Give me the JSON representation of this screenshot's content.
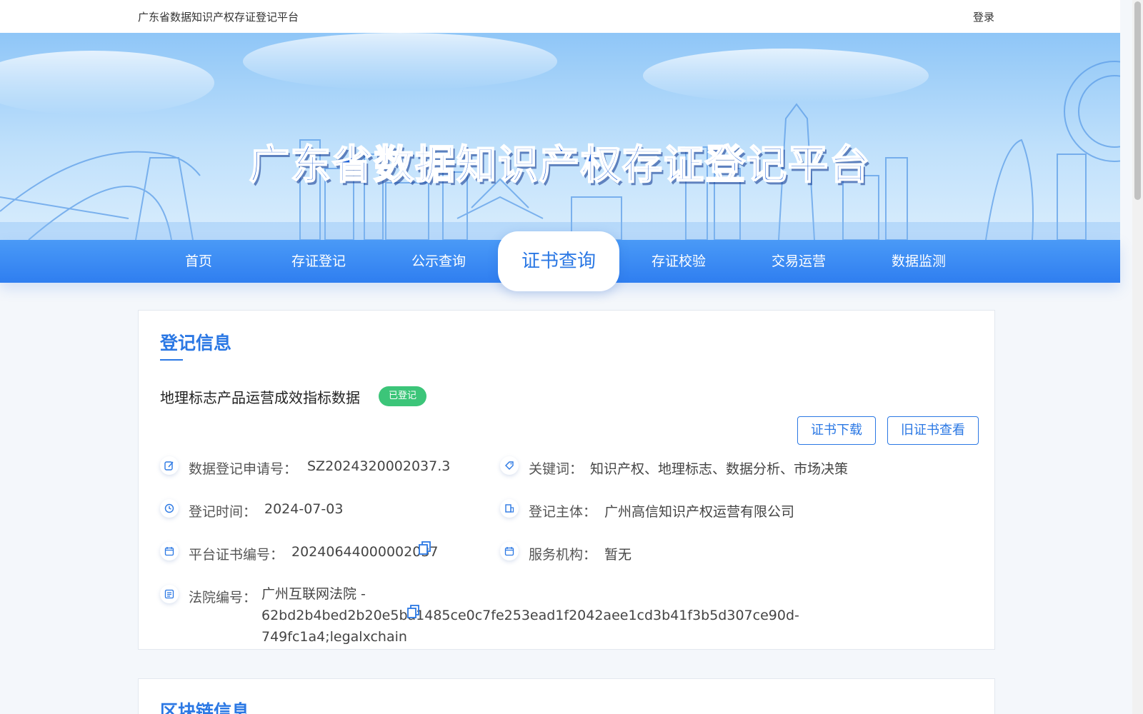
{
  "topbar": {
    "site_title": "广东省数据知识产权存证登记平台",
    "login_label": "登录"
  },
  "banner": {
    "title": "广东省数据知识产权存证登记平台"
  },
  "nav": {
    "items": [
      {
        "label": "首页"
      },
      {
        "label": "存证登记"
      },
      {
        "label": "公示查询"
      },
      {
        "label": "证书查询",
        "active": true
      },
      {
        "label": "存证校验"
      },
      {
        "label": "交易运营"
      },
      {
        "label": "数据监测"
      }
    ]
  },
  "registration": {
    "section_title": "登记信息",
    "record_title": "地理标志产品运营成效指标数据",
    "status": "已登记",
    "buttons": {
      "download": "证书下载",
      "old_view": "旧证书查看"
    },
    "fields": {
      "application_no_label": "数据登记申请号：",
      "application_no": "SZ2024320002037.3",
      "keywords_label": "关键词：",
      "keywords": "知识产权、地理标志、数据分析、市场决策",
      "reg_time_label": "登记时间：",
      "reg_time": "2024-07-03",
      "subject_label": "登记主体：",
      "subject": "广州高信知识产权运营有限公司",
      "cert_no_label": "平台证书编号：",
      "cert_no": "20240644000002037",
      "service_org_label": "服务机构：",
      "service_org": "暂无",
      "court_no_label": "法院编号：",
      "court_no": "广州互联网法院 - 62bd2b4bed2b20e5ba1485ce0c7fe253ead1f2042aee1cd3b41f3b5d307ce90d-749fc1a4;legalxchain"
    }
  },
  "blockchain": {
    "section_title": "区块链信息"
  },
  "colors": {
    "accent": "#2b78e4",
    "status_green": "#3cc579",
    "nav_blue": "#2f7ef0"
  }
}
